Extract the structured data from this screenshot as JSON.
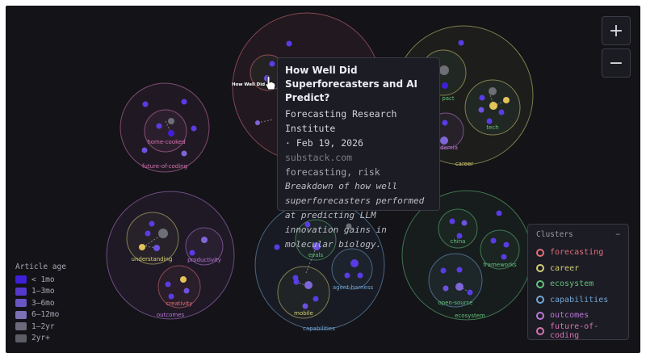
{
  "zoom": {
    "in_label": "+",
    "out_label": "−"
  },
  "clusters_panel": {
    "title": "Clusters",
    "collapse_label": "−",
    "items": [
      {
        "name": "forecasting",
        "color": "#e0707a"
      },
      {
        "name": "career",
        "color": "#d3cf73"
      },
      {
        "name": "ecosystem",
        "color": "#62c27a"
      },
      {
        "name": "capabilities",
        "color": "#73a6d6"
      },
      {
        "name": "outcomes",
        "color": "#b978d8"
      },
      {
        "name": "future-of-coding",
        "color": "#d674b4"
      }
    ]
  },
  "age_legend": {
    "title": "Article age",
    "items": [
      {
        "label": "< 1mo",
        "color": "#3f1fd8"
      },
      {
        "label": "1–3mo",
        "color": "#5638cc"
      },
      {
        "label": "3–6mo",
        "color": "#6a55c4"
      },
      {
        "label": "6–12mo",
        "color": "#7c71b4"
      },
      {
        "label": "1–2yr",
        "color": "#6c6a7a"
      },
      {
        "label": "2yr+",
        "color": "#5c5c64"
      }
    ]
  },
  "tooltip": {
    "title": "How Well Did Superforecasters and AI Predict?",
    "source": "Forecasting Research Institute",
    "date": "· Feb 19, 2026",
    "domain": "substack.com",
    "tags": "forecasting, risk",
    "summary": "Breakdown of how well superforecasters performed at predicting LLM innovation gains in molecular biology."
  },
  "node_hover_label": "How Well Did Su",
  "cluster_labels": {
    "future_of_coding": "future-of-coding",
    "home_cooked": "home-cooked",
    "outcomes": "outcomes",
    "understanding": "understanding",
    "productivity": "productivity",
    "creativity": "creativity",
    "capabilities": "capabilities",
    "evals": "evals",
    "agent_harness": "agent-harness",
    "mobile": "mobile",
    "career": "career",
    "impact": "pact",
    "tech": "tech",
    "academia": "demia",
    "ecosystem": "ecosystem",
    "china": "china",
    "frameworks": "frameworks",
    "open_source": "open-source"
  }
}
